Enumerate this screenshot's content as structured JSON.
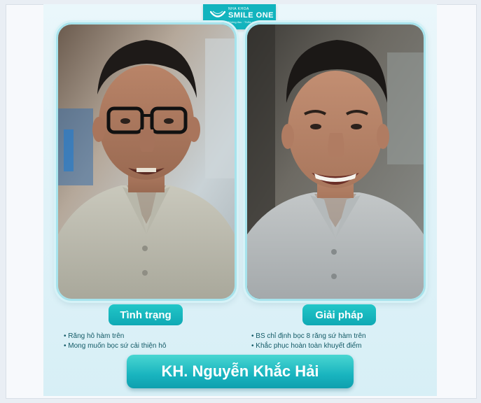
{
  "brand": {
    "small_text": "NHA KHOA",
    "name": "SMILE ONE",
    "tagline": "Không đau · Thẩm mỹ · Hiệu quả"
  },
  "photos": {
    "before_alt": "Tình trạng",
    "after_alt": "Giải pháp"
  },
  "status": {
    "title": "Tình trạng",
    "items": [
      "Răng hô hàm trên",
      "Mong muốn bọc sứ cải thiện hô"
    ]
  },
  "solution": {
    "title": "Giải pháp",
    "items": [
      "BS chỉ định bọc 8 răng sứ hàm trên",
      "Khắc phục hoàn toàn khuyết điểm"
    ]
  },
  "customer": {
    "name": "KH. Nguyễn Khắc Hải"
  },
  "colors": {
    "accent": "#12b4be",
    "background": "#dff2f8",
    "text": "#135a66"
  }
}
